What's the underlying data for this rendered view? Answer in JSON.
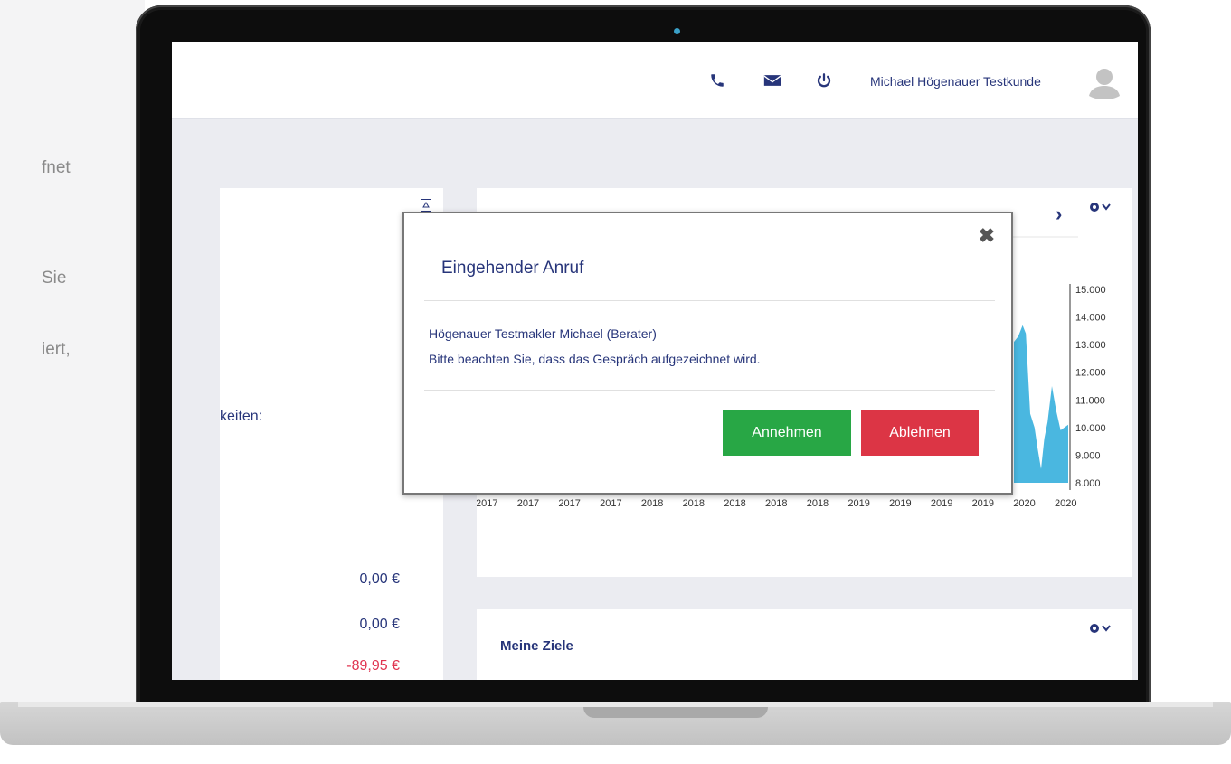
{
  "left_panel": {
    "lines": [
      "fnet",
      "Sie",
      "iert,"
    ]
  },
  "topbar": {
    "user_name": "Michael Högenauer Testkunde"
  },
  "left_card": {
    "label": "keiten:",
    "amounts": [
      "0,00 €",
      "0,00 €",
      "-89,95 €"
    ]
  },
  "chart_data": {
    "type": "area",
    "x_tick_labels": [
      "2017",
      "2017",
      "2017",
      "2017",
      "2018",
      "2018",
      "2018",
      "2018",
      "2018",
      "2019",
      "2019",
      "2019",
      "2019",
      "2020",
      "2020"
    ],
    "y_tick_labels": [
      "15.000",
      "14.000",
      "13.000",
      "12.000",
      "11.000",
      "10.000",
      "9.000",
      "8.000"
    ],
    "ylim": [
      8000,
      15000
    ],
    "visible_series_fragment": [
      {
        "x": 0.0,
        "y": 13100
      },
      {
        "x": 0.08,
        "y": 13300
      },
      {
        "x": 0.16,
        "y": 13700
      },
      {
        "x": 0.22,
        "y": 13400
      },
      {
        "x": 0.3,
        "y": 10500
      },
      {
        "x": 0.38,
        "y": 10000
      },
      {
        "x": 0.44,
        "y": 9200
      },
      {
        "x": 0.5,
        "y": 8500
      },
      {
        "x": 0.56,
        "y": 9600
      },
      {
        "x": 0.62,
        "y": 10200
      },
      {
        "x": 0.7,
        "y": 11500
      },
      {
        "x": 0.78,
        "y": 10600
      },
      {
        "x": 0.86,
        "y": 9900
      },
      {
        "x": 1.0,
        "y": 10100
      }
    ],
    "fill_color": "#4ab7e0",
    "grid": false
  },
  "goals_card": {
    "title": "Meine Ziele"
  },
  "modal": {
    "title": "Eingehender Anruf",
    "line1": "Högenauer Testmakler Michael (Berater)",
    "line2": "Bitte beachten Sie, dass das Gespräch aufgezeichnet wird.",
    "accept_label": "Annehmen",
    "reject_label": "Ablehnen",
    "close_glyph": "✖"
  },
  "icons": {
    "phone": "phone-icon",
    "mail": "mail-icon",
    "power": "power-icon",
    "avatar": "avatar-icon",
    "gear": "gear-icon",
    "chevron_right": "chevron-right-icon",
    "pdf": "pdf-icon",
    "trash": "trash-icon"
  },
  "colors": {
    "primary": "#27357a",
    "accept": "#28a745",
    "reject": "#dc3545",
    "negative_amount": "#e0334f",
    "chart_fill": "#4ab7e0"
  }
}
